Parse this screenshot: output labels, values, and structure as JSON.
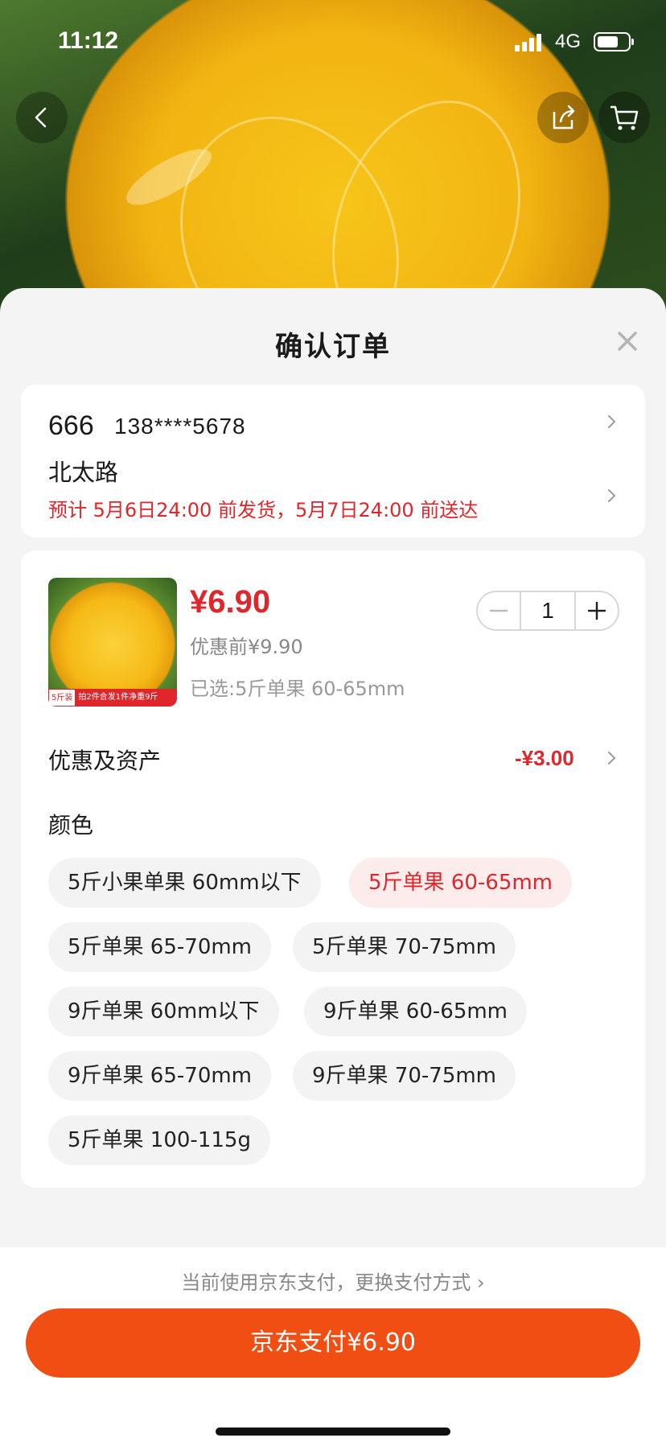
{
  "status_bar": {
    "time": "11:12",
    "network": "4G",
    "battery_level": 0.7
  },
  "header_icons": {
    "back": "chevron-left-icon",
    "share": "share-icon",
    "cart": "cart-icon"
  },
  "sheet": {
    "title": "确认订单",
    "close_icon": "close-icon"
  },
  "address": {
    "name": "666",
    "phone": "138****5678",
    "line": "北太路",
    "delivery": "预计 5月6日24:00 前发货，5月7日24:00 前送达"
  },
  "product": {
    "tag_a": "5斤装",
    "tag_b": "拍2件合发1件净重9斤",
    "price": "¥6.90",
    "original_price": "优惠前¥9.90",
    "selected": "已选:5斤单果 60-65mm",
    "quantity": "1"
  },
  "discount": {
    "label": "优惠及资产",
    "value": "-¥3.00"
  },
  "color": {
    "label": "颜色",
    "options": [
      "5斤小果单果 60mm以下",
      "5斤单果 60-65mm",
      "5斤单果 65-70mm",
      "5斤单果 70-75mm",
      "9斤单果 60mm以下",
      "9斤单果 60-65mm",
      "9斤单果 65-70mm",
      "9斤单果 70-75mm",
      "5斤单果 100-115g"
    ],
    "selected_index": 1
  },
  "payment": {
    "switch_text": "当前使用京东支付，更换支付方式 ›",
    "pay_button": "京东支付¥6.90"
  },
  "colors": {
    "accent": "#e0262b",
    "pay_button": "#f04e12"
  }
}
